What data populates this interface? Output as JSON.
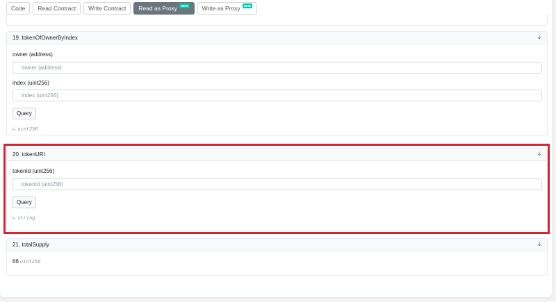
{
  "tabs": [
    {
      "label": "Code"
    },
    {
      "label": "Read Contract"
    },
    {
      "label": "Write Contract"
    },
    {
      "label": "Read as Proxy",
      "badge": "NEW"
    },
    {
      "label": "Write as Proxy",
      "badge": "NEW"
    }
  ],
  "sections": [
    {
      "title": "19. tokenOfOwnerByIndex",
      "params": [
        {
          "label": "owner (address)",
          "placeholder": "owner (address)"
        },
        {
          "label": "index (uint256)",
          "placeholder": "index (uint256)"
        }
      ],
      "query_label": "Query",
      "return_type": "uint256"
    },
    {
      "title": "20. tokenURI",
      "params": [
        {
          "label": "tokenId (uint256)",
          "placeholder": "tokenId (uint256)"
        }
      ],
      "query_label": "Query",
      "return_type": "string"
    },
    {
      "title": "21. totalSupply",
      "value": "66",
      "return_type": "uint256"
    }
  ],
  "icons": {
    "collapse": "arrow-down-icon",
    "return": "return-arrow-icon"
  },
  "colors": {
    "highlight": "#d9232e",
    "badge": "#00c9a7",
    "active_tab": "#6c757d"
  }
}
